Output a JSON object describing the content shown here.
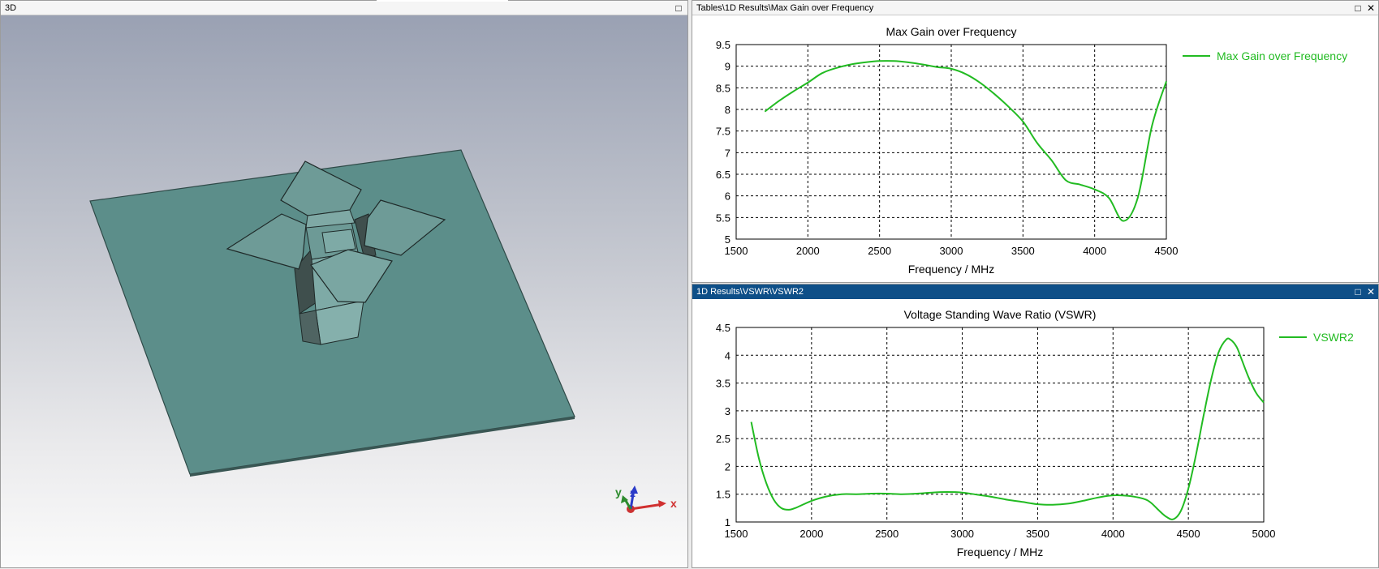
{
  "window_3d": {
    "title": "3D"
  },
  "axes_triad": {
    "x": "x",
    "y": "y",
    "z": "z"
  },
  "gain_panel": {
    "title": "Tables\\1D Results\\Max Gain over Frequency"
  },
  "vswr_panel": {
    "title": "1D Results\\VSWR\\VSWR2"
  },
  "colors": {
    "curve": "#22bb22",
    "plate": "#5c8e8a",
    "active_title": "#0e4f88"
  },
  "icons": [
    "maximize-icon",
    "close-icon"
  ],
  "chart_data": [
    {
      "type": "line",
      "title": "Max Gain over Frequency",
      "xlabel": "Frequency / MHz",
      "ylabel": "",
      "xlim": [
        1500,
        4500
      ],
      "ylim": [
        5,
        9.5
      ],
      "xticks": [
        1500,
        2000,
        2500,
        3000,
        3500,
        4000,
        4500
      ],
      "yticks": [
        5,
        5.5,
        6,
        6.5,
        7,
        7.5,
        8,
        8.5,
        9,
        9.5
      ],
      "grid": true,
      "legend_position": "right",
      "series": [
        {
          "name": "Max Gain over Frequency",
          "color": "#22bb22",
          "x": [
            1700,
            1800,
            1900,
            2000,
            2100,
            2200,
            2300,
            2400,
            2500,
            2600,
            2700,
            2800,
            2900,
            3000,
            3100,
            3200,
            3300,
            3400,
            3500,
            3600,
            3700,
            3800,
            3900,
            4000,
            4100,
            4200,
            4300,
            4400,
            4500
          ],
          "y": [
            7.95,
            8.2,
            8.42,
            8.62,
            8.84,
            8.96,
            9.04,
            9.09,
            9.12,
            9.12,
            9.09,
            9.04,
            8.98,
            8.94,
            8.82,
            8.62,
            8.36,
            8.06,
            7.72,
            7.22,
            6.82,
            6.36,
            6.26,
            6.15,
            5.95,
            5.42,
            5.95,
            7.62,
            8.65
          ]
        }
      ]
    },
    {
      "type": "line",
      "title": "Voltage Standing Wave Ratio (VSWR)",
      "xlabel": "Frequency / MHz",
      "ylabel": "",
      "xlim": [
        1500,
        5000
      ],
      "ylim": [
        1,
        4.5
      ],
      "xticks": [
        1500,
        2000,
        2500,
        3000,
        3500,
        4000,
        4500,
        5000
      ],
      "yticks": [
        1,
        1.5,
        2,
        2.5,
        3,
        3.5,
        4,
        4.5
      ],
      "grid": true,
      "legend_position": "right",
      "series": [
        {
          "name": "VSWR2",
          "color": "#22bb22",
          "x": [
            1600,
            1650,
            1700,
            1750,
            1800,
            1850,
            1900,
            2000,
            2100,
            2200,
            2300,
            2400,
            2500,
            2600,
            2700,
            2800,
            2900,
            3000,
            3100,
            3200,
            3300,
            3400,
            3500,
            3600,
            3700,
            3800,
            3900,
            4000,
            4100,
            4200,
            4250,
            4300,
            4350,
            4400,
            4450,
            4500,
            4550,
            4600,
            4650,
            4700,
            4750,
            4780,
            4820,
            4850,
            4900,
            4950,
            5000
          ],
          "y": [
            2.8,
            2.15,
            1.7,
            1.4,
            1.25,
            1.22,
            1.26,
            1.38,
            1.46,
            1.5,
            1.5,
            1.51,
            1.51,
            1.5,
            1.51,
            1.53,
            1.54,
            1.53,
            1.49,
            1.45,
            1.4,
            1.36,
            1.32,
            1.31,
            1.33,
            1.38,
            1.44,
            1.48,
            1.47,
            1.42,
            1.35,
            1.22,
            1.1,
            1.05,
            1.2,
            1.6,
            2.2,
            2.9,
            3.55,
            4.05,
            4.28,
            4.28,
            4.15,
            3.95,
            3.6,
            3.32,
            3.15
          ]
        }
      ]
    }
  ]
}
